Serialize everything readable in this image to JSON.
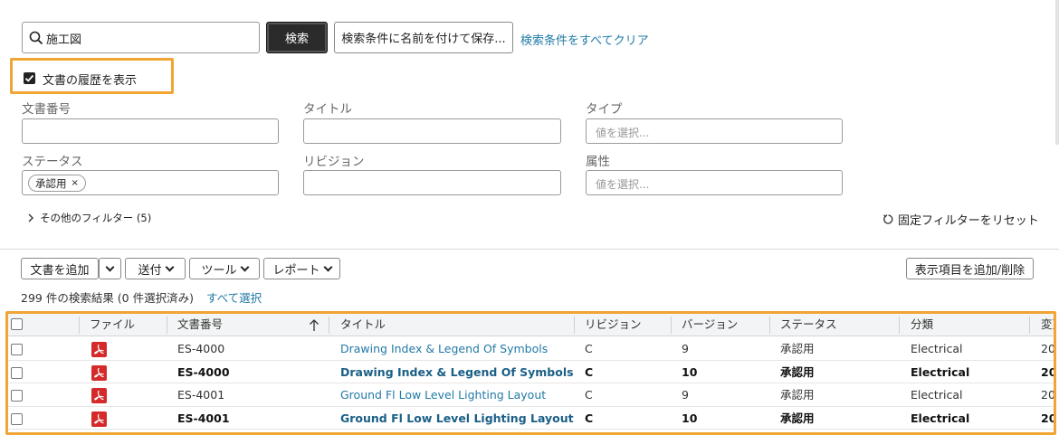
{
  "search": {
    "value": "施工図",
    "search_button": "検索",
    "save_button": "検索条件に名前を付けて保存...",
    "clear_link": "検索条件をすべてクリア"
  },
  "history_checkbox": {
    "label": "文書の履歴を表示",
    "checked": true
  },
  "filters": {
    "doc_number": {
      "label": "文書番号"
    },
    "title": {
      "label": "タイトル"
    },
    "type": {
      "label": "タイプ",
      "placeholder": "値を選択..."
    },
    "status": {
      "label": "ステータス",
      "chip": "承認用"
    },
    "revision": {
      "label": "リビジョン"
    },
    "attribute": {
      "label": "属性",
      "placeholder": "値を選択..."
    },
    "more_filters": "その他のフィルター (5)",
    "reset_fixed": "固定フィルターをリセット"
  },
  "toolbar": {
    "add_document": "文書を追加",
    "send": "送付",
    "tools": "ツール",
    "report": "レポート",
    "columns": "表示項目を追加/削除"
  },
  "results": {
    "summary": "299 件の検索結果 (0 件選択済み)",
    "select_all": "すべて選択"
  },
  "table": {
    "headers": {
      "file": "ファイル",
      "doc_number": "文書番号",
      "title": "タイトル",
      "revision": "リビジョン",
      "version": "バージョン",
      "status": "ステータス",
      "category": "分類",
      "changed": "変更"
    },
    "rows": [
      {
        "doc_number": "ES-4000",
        "title": "Drawing Index & Legend Of Symbols",
        "revision": "C",
        "version": "9",
        "status": "承認用",
        "category": "Electrical",
        "changed": "20"
      },
      {
        "doc_number": "ES-4000",
        "title": "Drawing Index & Legend Of Symbols",
        "revision": "C",
        "version": "10",
        "status": "承認用",
        "category": "Electrical",
        "changed": "20"
      },
      {
        "doc_number": "ES-4001",
        "title": "Ground Fl Low Level Lighting Layout",
        "revision": "C",
        "version": "9",
        "status": "承認用",
        "category": "Electrical",
        "changed": "20"
      },
      {
        "doc_number": "ES-4001",
        "title": "Ground Fl Low Level Lighting Layout",
        "revision": "C",
        "version": "10",
        "status": "承認用",
        "category": "Electrical",
        "changed": "20"
      }
    ]
  },
  "colors": {
    "accent": "#227aa6",
    "highlight": "#f0a535",
    "search_button": "#2b2b2b",
    "pdf_icon": "#d42a2a"
  }
}
